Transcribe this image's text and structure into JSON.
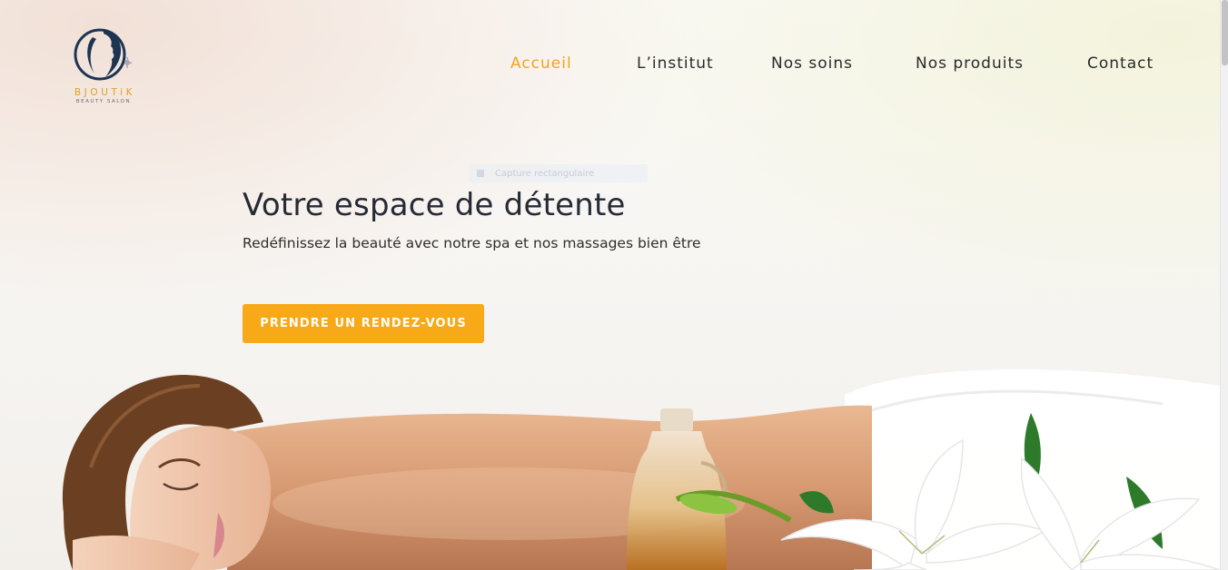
{
  "brand": {
    "name": "BJOUTiK",
    "tagline": "BEAUTY SALON",
    "icon": "woman-profile-logo",
    "accent_color": "#f8a918",
    "logo_color": "#1d3553"
  },
  "nav": {
    "items": [
      {
        "label": "Accueil",
        "active": true
      },
      {
        "label": "L’institut",
        "active": false
      },
      {
        "label": "Nos soins",
        "active": false
      },
      {
        "label": "Nos produits",
        "active": false
      },
      {
        "label": "Contact",
        "active": false
      }
    ]
  },
  "ghost_label": "Capture rectangulaire",
  "hero": {
    "title": "Votre espace de détente",
    "subtitle": "Redéfinissez la beauté avec notre spa et nos massages bien être",
    "cta_label": "PRENDRE UN RENDEZ-VOUS",
    "image": "spa-massage-woman-lying-with-oil-bottle-and-lilies"
  }
}
